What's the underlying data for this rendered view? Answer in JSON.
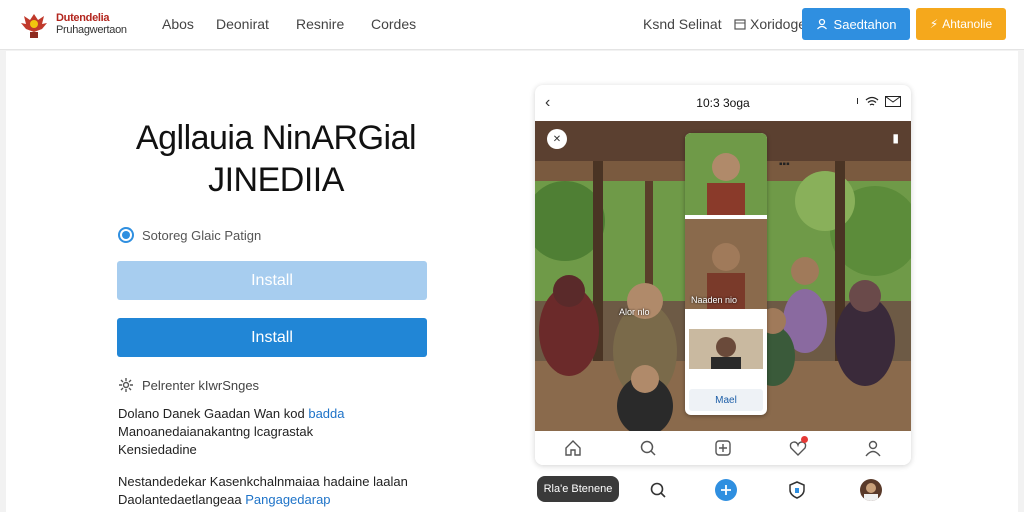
{
  "header": {
    "logo_line1": "Dutendelia",
    "logo_line2": "Pruhagwertaon",
    "nav": [
      "Abos",
      "Deonirat",
      "Resnire",
      "Cordes"
    ],
    "right_link1": "Ksnd  Selinat",
    "right_link2": "Xoridoge",
    "btn_primary": "Saedtahon",
    "btn_secondary": "Ahtanolie"
  },
  "hero": {
    "headline_line1": "Agllauia NinARGial",
    "headline_line2": "JINEDIIA",
    "radio_label": "Sotoreg Glaic Patign",
    "install_light": "Install",
    "install_dark": "Install",
    "feature_label": "Pelrenter kIwrSnges",
    "para1_line1": "Dolano Danek Gaadan",
    "para1_line1b": "Wan kod",
    "para1_link1": "badda",
    "para1_line2": "Manoanedaianakantng lcagrastak",
    "para1_line3": "Kensiedadine",
    "para2_line1": "Nestandedekar Kasenkchalnmaiaa hadaine laalan",
    "para2_line2": "Daolantedaetlangeaa",
    "para2_link": "Pangagedarap"
  },
  "phone": {
    "title": "10:3 3oga",
    "overlay_caption": "Naaden nio",
    "overlay_button": "Mael",
    "photo_caption": "Alor nlo"
  },
  "bottom": {
    "pill": "Rla'e Btenene"
  },
  "colors": {
    "accent_blue": "#2f8fe0",
    "accent_orange": "#f5a81c",
    "install_dark": "#2186d6",
    "install_light": "#a7cdef"
  }
}
